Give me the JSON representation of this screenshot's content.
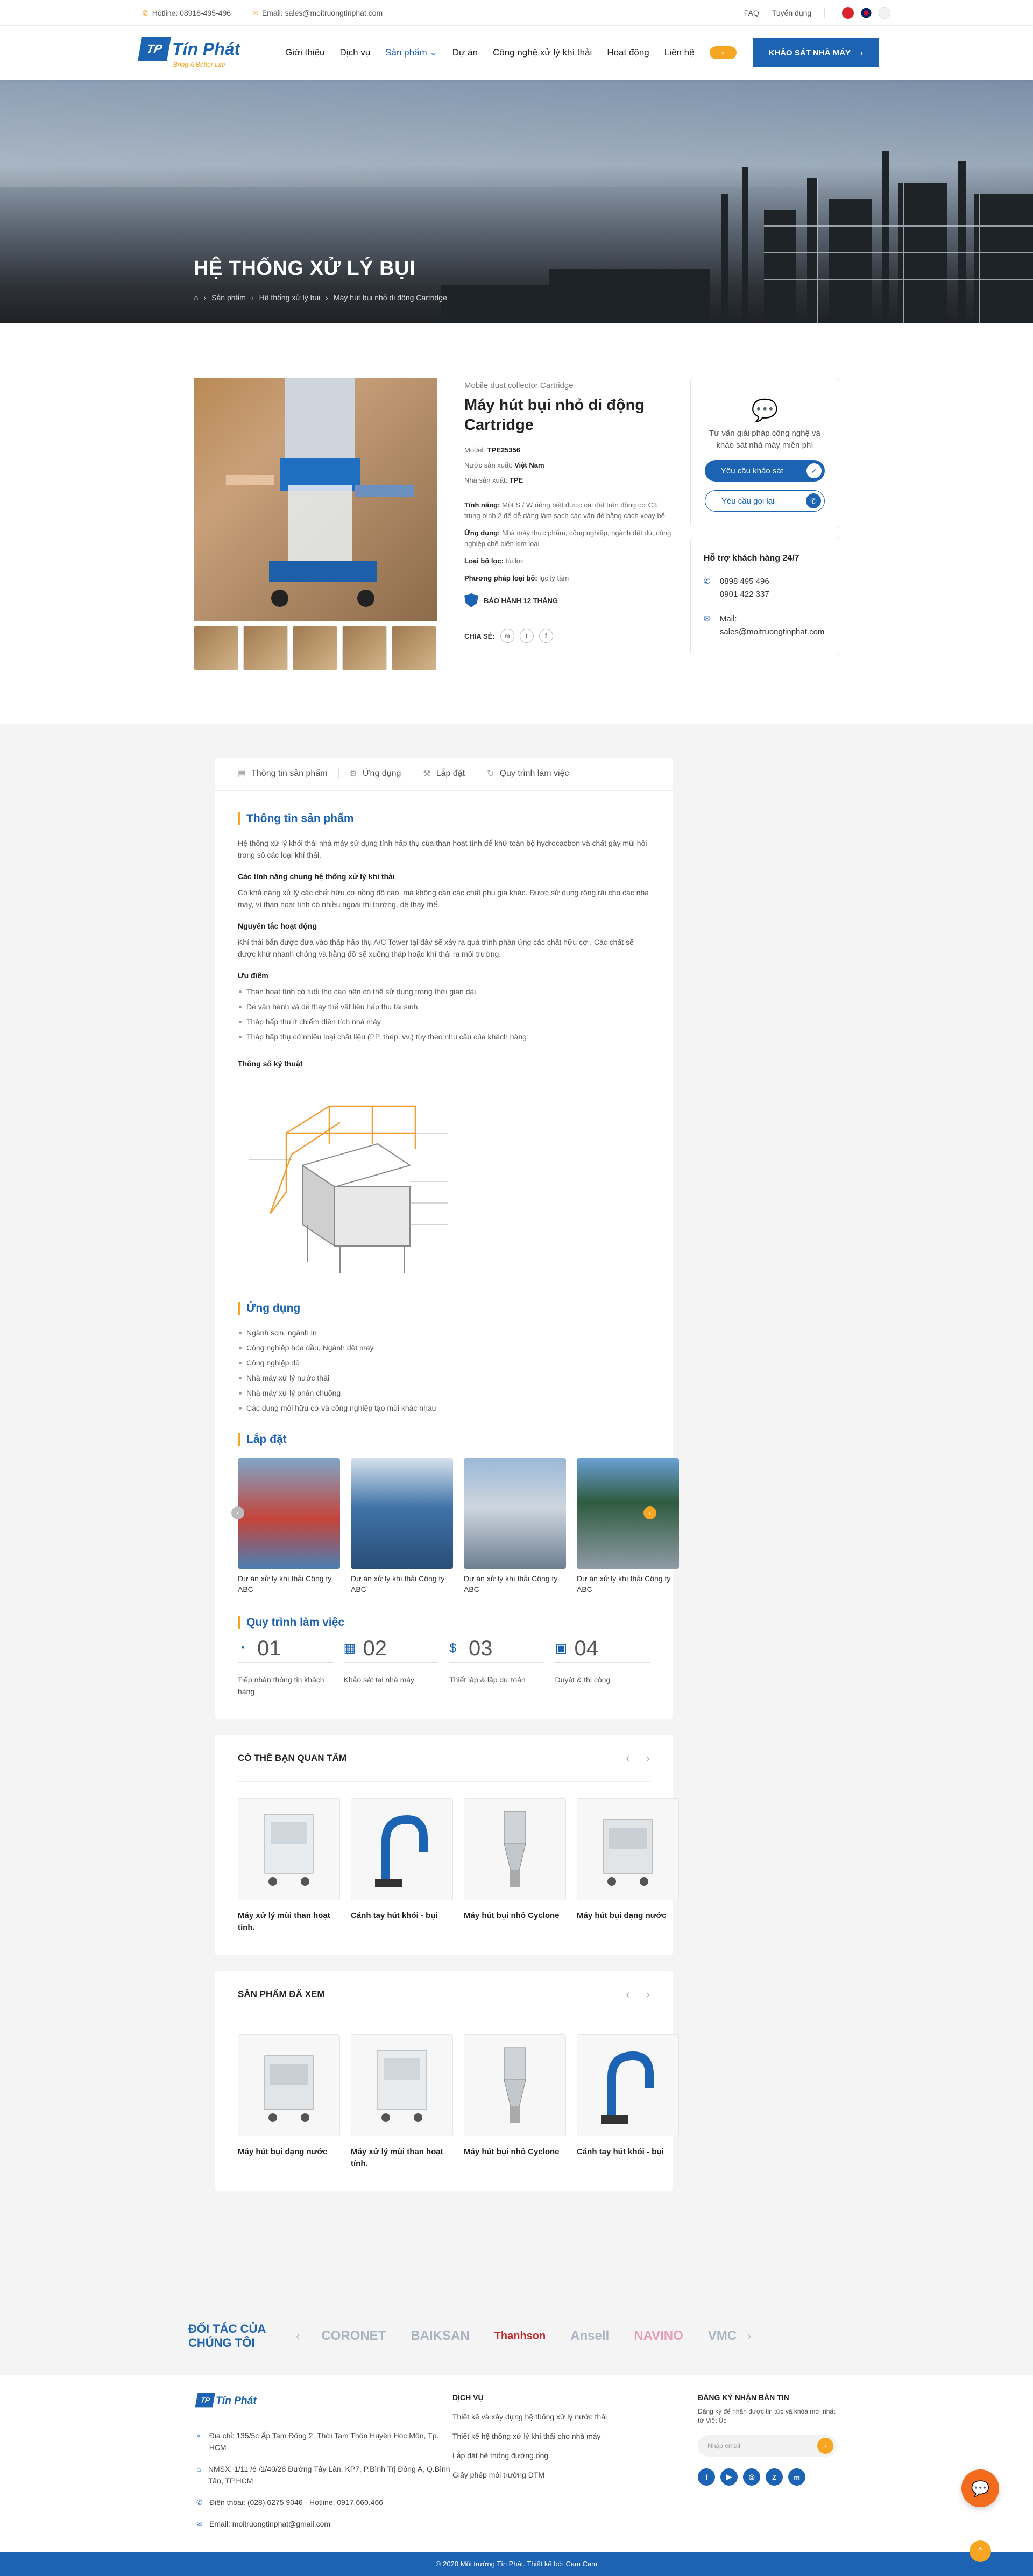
{
  "topbar": {
    "hotline": "Hotline: 08918-495-496",
    "email": "Email: sales@moitruongtinphat.com",
    "faq": "FAQ",
    "recruit": "Tuyển dụng"
  },
  "brand": {
    "name": "Tín Phát",
    "slogan": "Bring A Better Life",
    "badge": "TP"
  },
  "nav": {
    "items": [
      "Giới thiệu",
      "Dịch vụ",
      "Sản phẩm",
      "Dự án",
      "Công nghệ xử lý khí thải",
      "Hoạt động",
      "Liên hệ"
    ],
    "cta": "KHẢO SÁT NHÀ MÁY"
  },
  "banner": {
    "title": "HỆ THỐNG XỬ LÝ BỤI",
    "breadcrumb": [
      "Sản phẩm",
      "Hệ thống xử lý bụi",
      "Máy hút bụi nhỏ di động Cartridge"
    ]
  },
  "product": {
    "subtitle": "Mobile dust collector Cartridge",
    "title": "Máy hút bụi nhỏ di động Cartridge",
    "model_label": "Model:",
    "model": "TPE25356",
    "origin_label": "Nước sản xuất:",
    "origin": "Việt Nam",
    "maker_label": "Nhà sản xuất:",
    "maker": "TPE",
    "feature_label": "Tính năng:",
    "feature": "Một S / W riêng biệt được cài đặt trên động cơ C3 trung bình 2 để dễ dàng làm sạch các vấn đề bằng cách xoay bể",
    "usage_label": "Ứng dụng:",
    "usage": "Nhà máy thực phẩm, công nghiệp, ngành dệt dù, công nghiệp chế biến kim loại",
    "filter_label": "Loại bộ lọc:",
    "filter": "túi lọc",
    "method_label": "Phương pháp loại bỏ:",
    "method": "lục lý tâm",
    "warranty": "BẢO HÀNH 12 THÁNG",
    "share": "CHIA SẺ:"
  },
  "consult": {
    "text": "Tư vấn giải pháp công nghệ và khảo sát nhà máy miễn phí",
    "btn_survey": "Yêu cầu khảo sát",
    "btn_call": "Yêu cầu gọi lại"
  },
  "support": {
    "title": "Hỗ trợ khách hàng 24/7",
    "phone1": "0898 495 496",
    "phone2": "0901 422 337",
    "mail_label": "Mail:",
    "mail": "sales@moitruongtinphat.com"
  },
  "tabs": [
    "Thông tin sản phẩm",
    "Ứng dụng",
    "Lắp đặt",
    "Quy trình làm việc"
  ],
  "info": {
    "heading": "Thông tin sản phẩm",
    "intro": "Hệ thống xử lý khói thải nhà máy sử dụng tính hấp thụ của than hoạt tính để khử toàn bộ hydrocacbon và chất gây mùi hôi trong số các loại khí thải.",
    "h1": "Các tính năng chung hệ thống xử lý khí thải",
    "p1": "Có khả năng xử lý các chất hữu cơ nồng độ cao, mà không cần các chất phụ gia khác. Được sử dụng rộng rãi cho các nhà máy, vì than hoạt tính có nhiều ngoài thị trường, dễ thay thế.",
    "h2": "Nguyên tắc hoạt động",
    "p2": "Khí thải bẩn được đưa vào tháp hấp thụ A/C Tower tại đây sẽ xảy ra quá trình phản ứng các chất hữu cơ . Các chất sẽ được khử nhanh chóng và hằng đỡ sẽ xuống tháp hoặc khí thải ra môi trường.",
    "h3": "Ưu điểm",
    "adv": [
      "Than hoạt tính có tuổi thọ cao nên có thể sử dụng trong thời gian dài.",
      "Dễ vận hành và dễ thay thế vật liệu hấp thụ tái sinh.",
      "Tháp hấp thụ ít chiếm diện tích nhà máy.",
      "Tháp hấp thụ có nhiều loại chất liệu (PP, thép, vv.) tùy theo nhu cầu của khách hàng"
    ],
    "h4": "Thông số kỹ thuật"
  },
  "application": {
    "heading": "Ứng dụng",
    "items": [
      "Ngành sơn, ngành in",
      "Công nghiệp hóa dầu, Ngành dệt may",
      "Công nghiệp dù",
      "Nhà máy xử lý nước thải",
      "Nhà máy xử lý phân chuồng",
      "Các dung môi hữu cơ và công nghiệp tạo mùi khác nhau"
    ]
  },
  "install": {
    "heading": "Lắp đặt",
    "items": [
      "Dự án xử lý khí thải Công ty ABC",
      "Dự án xử lý khí thải Công ty ABC",
      "Dự án xử lý khí thải Công ty ABC",
      "Dự án xử lý khí thải Công ty ABC"
    ]
  },
  "process": {
    "heading": "Quy trình làm việc",
    "steps": [
      {
        "num": "01",
        "label": "Tiếp nhận thông tin khách hàng"
      },
      {
        "num": "02",
        "label": "Khảo sát tại nhà máy"
      },
      {
        "num": "03",
        "label": "Thiết lập & lập dự toán"
      },
      {
        "num": "04",
        "label": "Duyệt & thi công"
      }
    ]
  },
  "related": {
    "title": "CÓ THỂ BẠN QUAN TÂM",
    "items": [
      "Máy xử lý mùi than hoạt tính.",
      "Cánh tay hút khói - bụi",
      "Máy hút bụi nhỏ Cyclone",
      "Máy hút bụi dạng nước"
    ]
  },
  "viewed": {
    "title": "SẢN PHẨM ĐÃ XEM",
    "items": [
      "Máy hút bụi dạng nước",
      "Máy xử lý mùi than hoạt tính.",
      "Máy hút bụi nhỏ Cyclone",
      "Cánh tay hút khói - bụi"
    ]
  },
  "partners": {
    "title": "ĐỐI TÁC CỦA CHÚNG TÔI",
    "logos": [
      "CORONET",
      "BAIKSAN",
      "Thanhson",
      "Ansell",
      "NAVINO",
      "VMC"
    ]
  },
  "footer": {
    "addr1": "Địa chỉ: 135/5c Ấp Tam Đông 2, Thới Tam Thôn Huyện Hóc Môn, Tp. HCM",
    "addr2": "NMSX: 1/11 /6 /1/40/28 Đường Tây Lân, KP7, P.Bình Trị Đông A, Q.Bình Tân, TP.HCM",
    "phone": "Điện thoại: (028) 6275 9046 - Hotline: 0917.660.466",
    "email": "Email: moitruongtinphat@gmail.com",
    "services_title": "DỊCH VỤ",
    "services": [
      "Thiết kế và xây dựng hệ thống xử lý nước thải",
      "Thiết kế hệ thống xử lý khí thải cho nhà máy",
      "Lắp đặt hệ thống đường ống",
      "Giấy phép môi trường DTM"
    ],
    "newsletter_title": "ĐĂNG KÝ NHẬN BẢN TIN",
    "newsletter_text": "Đăng ký để nhận được tin tức và khóa mới nhất từ Việt Úc",
    "newsletter_placeholder": "Nhập email",
    "copyright": "© 2020 Môi trường Tín Phát. Thiết kế bởi Cam Cam"
  }
}
